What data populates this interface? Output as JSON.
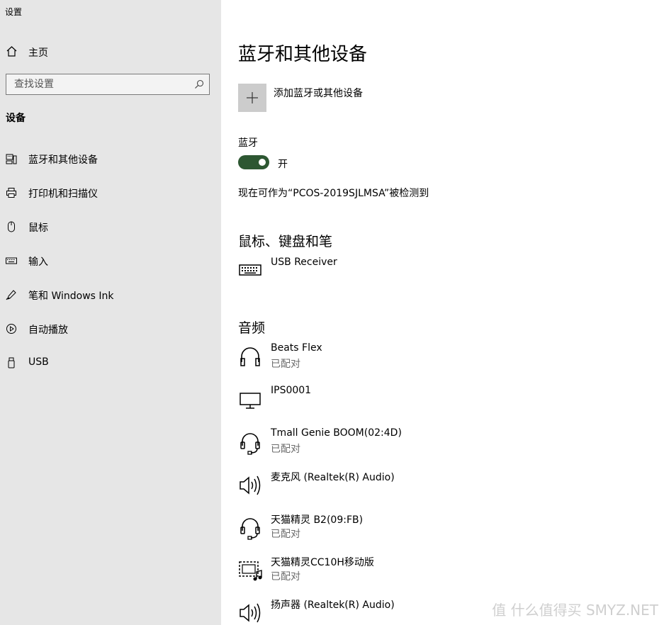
{
  "window": {
    "title": "设置"
  },
  "sidebar": {
    "home_label": "主页",
    "search_placeholder": "查找设置",
    "section_title": "设备",
    "items": [
      {
        "label": "蓝牙和其他设备",
        "icon": "bluetooth-devices-icon"
      },
      {
        "label": "打印机和扫描仪",
        "icon": "printer-icon"
      },
      {
        "label": "鼠标",
        "icon": "mouse-icon"
      },
      {
        "label": "输入",
        "icon": "keyboard-icon"
      },
      {
        "label": "笔和 Windows Ink",
        "icon": "pen-icon"
      },
      {
        "label": "自动播放",
        "icon": "autoplay-icon"
      },
      {
        "label": "USB",
        "icon": "usb-icon"
      }
    ]
  },
  "main": {
    "title": "蓝牙和其他设备",
    "add_device_label": "添加蓝牙或其他设备",
    "bluetooth_label": "蓝牙",
    "bluetooth_state": "开",
    "discoverable_text": "现在可作为“PCOS-2019SJLMSA”被检测到",
    "groups": {
      "input_title": "鼠标、键盘和笔",
      "audio_title": "音频"
    },
    "input_devices": [
      {
        "name": "USB Receiver",
        "status": "",
        "icon": "keyboard-icon"
      }
    ],
    "audio_devices": [
      {
        "name": "Beats Flex",
        "status": "已配对",
        "icon": "headphones-icon"
      },
      {
        "name": "IPS0001",
        "status": "",
        "icon": "monitor-icon"
      },
      {
        "name": "Tmall Genie BOOM(02:4D)",
        "status": "已配对",
        "icon": "headset-icon"
      },
      {
        "name": "麦克风 (Realtek(R) Audio)",
        "status": "",
        "icon": "speaker-icon"
      },
      {
        "name": "天猫精灵 B2(09:FB)",
        "status": "已配对",
        "icon": "headset-icon"
      },
      {
        "name": "天猫精灵CC10H移动版",
        "status": "已配对",
        "icon": "media-player-icon"
      },
      {
        "name": "扬声器 (Realtek(R) Audio)",
        "status": "",
        "icon": "speaker-icon"
      }
    ]
  },
  "watermark": "值 什么值得买 SMYZ.NET"
}
